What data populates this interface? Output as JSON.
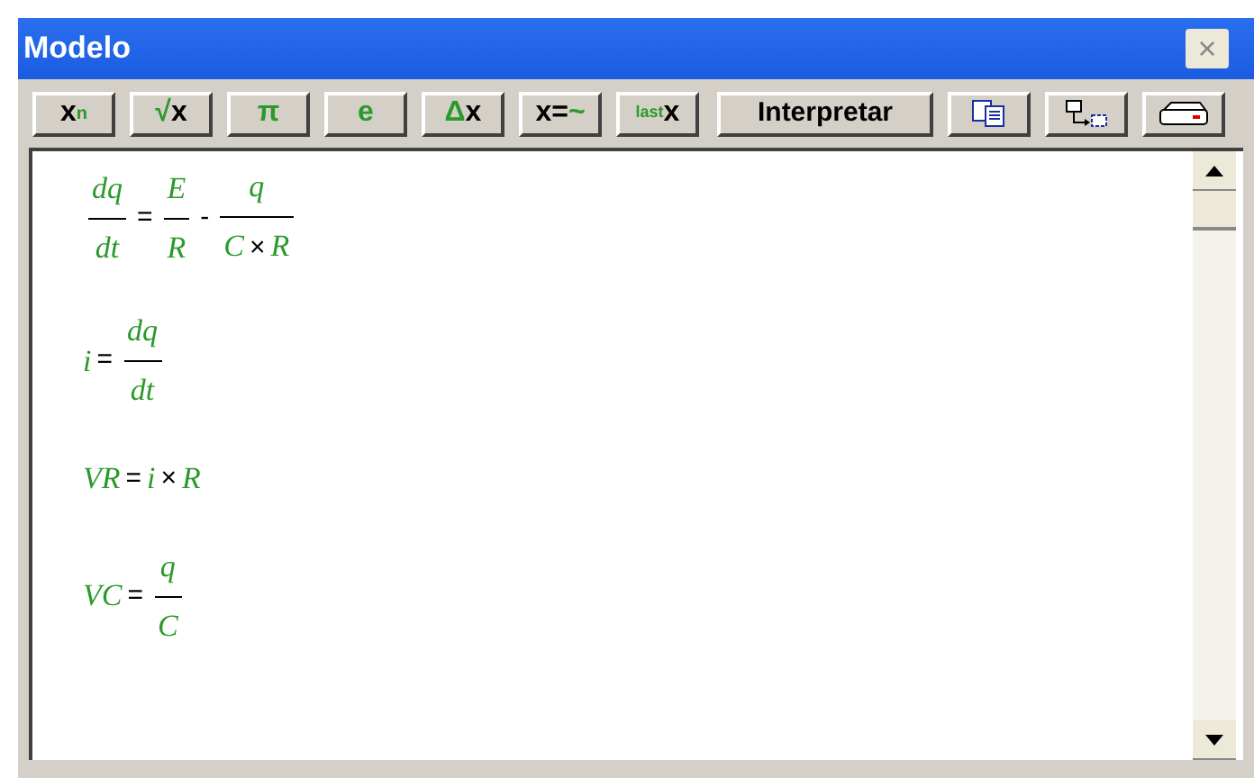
{
  "window": {
    "title": "Modelo",
    "close": "×"
  },
  "toolbar": [
    {
      "kind": "text",
      "parts": [
        {
          "text": "x",
          "kind": "plain"
        },
        {
          "text": "n",
          "kind": "sup"
        }
      ]
    },
    {
      "kind": "text",
      "parts": [
        {
          "text": "√",
          "kind": "accent"
        },
        {
          "text": "x",
          "kind": "plain"
        }
      ]
    },
    {
      "kind": "text",
      "parts": [
        {
          "text": "π",
          "kind": "accent"
        }
      ]
    },
    {
      "kind": "text",
      "parts": [
        {
          "text": "e",
          "kind": "accent"
        }
      ]
    },
    {
      "kind": "text",
      "parts": [
        {
          "text": "Δ",
          "kind": "accent"
        },
        {
          "text": "x",
          "kind": "plain"
        }
      ]
    },
    {
      "kind": "text",
      "parts": [
        {
          "text": "x=",
          "kind": "plain"
        },
        {
          "text": "~",
          "kind": "accent"
        }
      ]
    },
    {
      "kind": "text",
      "parts": [
        {
          "text": "last",
          "kind": "sub"
        },
        {
          "text": "x",
          "kind": "plain"
        }
      ]
    },
    {
      "kind": "label",
      "label": "Interpretar"
    },
    {
      "kind": "copy"
    },
    {
      "kind": "transfer"
    },
    {
      "kind": "print"
    }
  ],
  "equations": [
    [
      {
        "kind": "frac",
        "num": [
          {
            "kind": "var",
            "text": "dq"
          }
        ],
        "den": [
          {
            "kind": "var",
            "text": "dt"
          }
        ]
      },
      {
        "kind": "op",
        "text": "="
      },
      {
        "kind": "frac",
        "num": [
          {
            "kind": "var",
            "text": "E"
          }
        ],
        "den": [
          {
            "kind": "var",
            "text": "R"
          }
        ]
      },
      {
        "kind": "op",
        "text": "-"
      },
      {
        "kind": "frac",
        "num": [
          {
            "kind": "var",
            "text": "q"
          }
        ],
        "den": [
          {
            "kind": "var",
            "text": "C"
          },
          {
            "kind": "op",
            "text": "×"
          },
          {
            "kind": "var",
            "text": "R"
          }
        ]
      }
    ],
    [
      {
        "kind": "var",
        "text": "i"
      },
      {
        "kind": "op",
        "text": "="
      },
      {
        "kind": "frac",
        "num": [
          {
            "kind": "var",
            "text": "dq"
          }
        ],
        "den": [
          {
            "kind": "var",
            "text": "dt"
          }
        ]
      }
    ],
    [
      {
        "kind": "var",
        "text": "VR"
      },
      {
        "kind": "op",
        "text": "="
      },
      {
        "kind": "var",
        "text": "i"
      },
      {
        "kind": "op",
        "text": "×"
      },
      {
        "kind": "var",
        "text": "R"
      }
    ],
    [
      {
        "kind": "var",
        "text": "VC"
      },
      {
        "kind": "op",
        "text": "="
      },
      {
        "kind": "frac",
        "num": [
          {
            "kind": "var",
            "text": "q"
          }
        ],
        "den": [
          {
            "kind": "var",
            "text": "C"
          }
        ]
      }
    ]
  ]
}
